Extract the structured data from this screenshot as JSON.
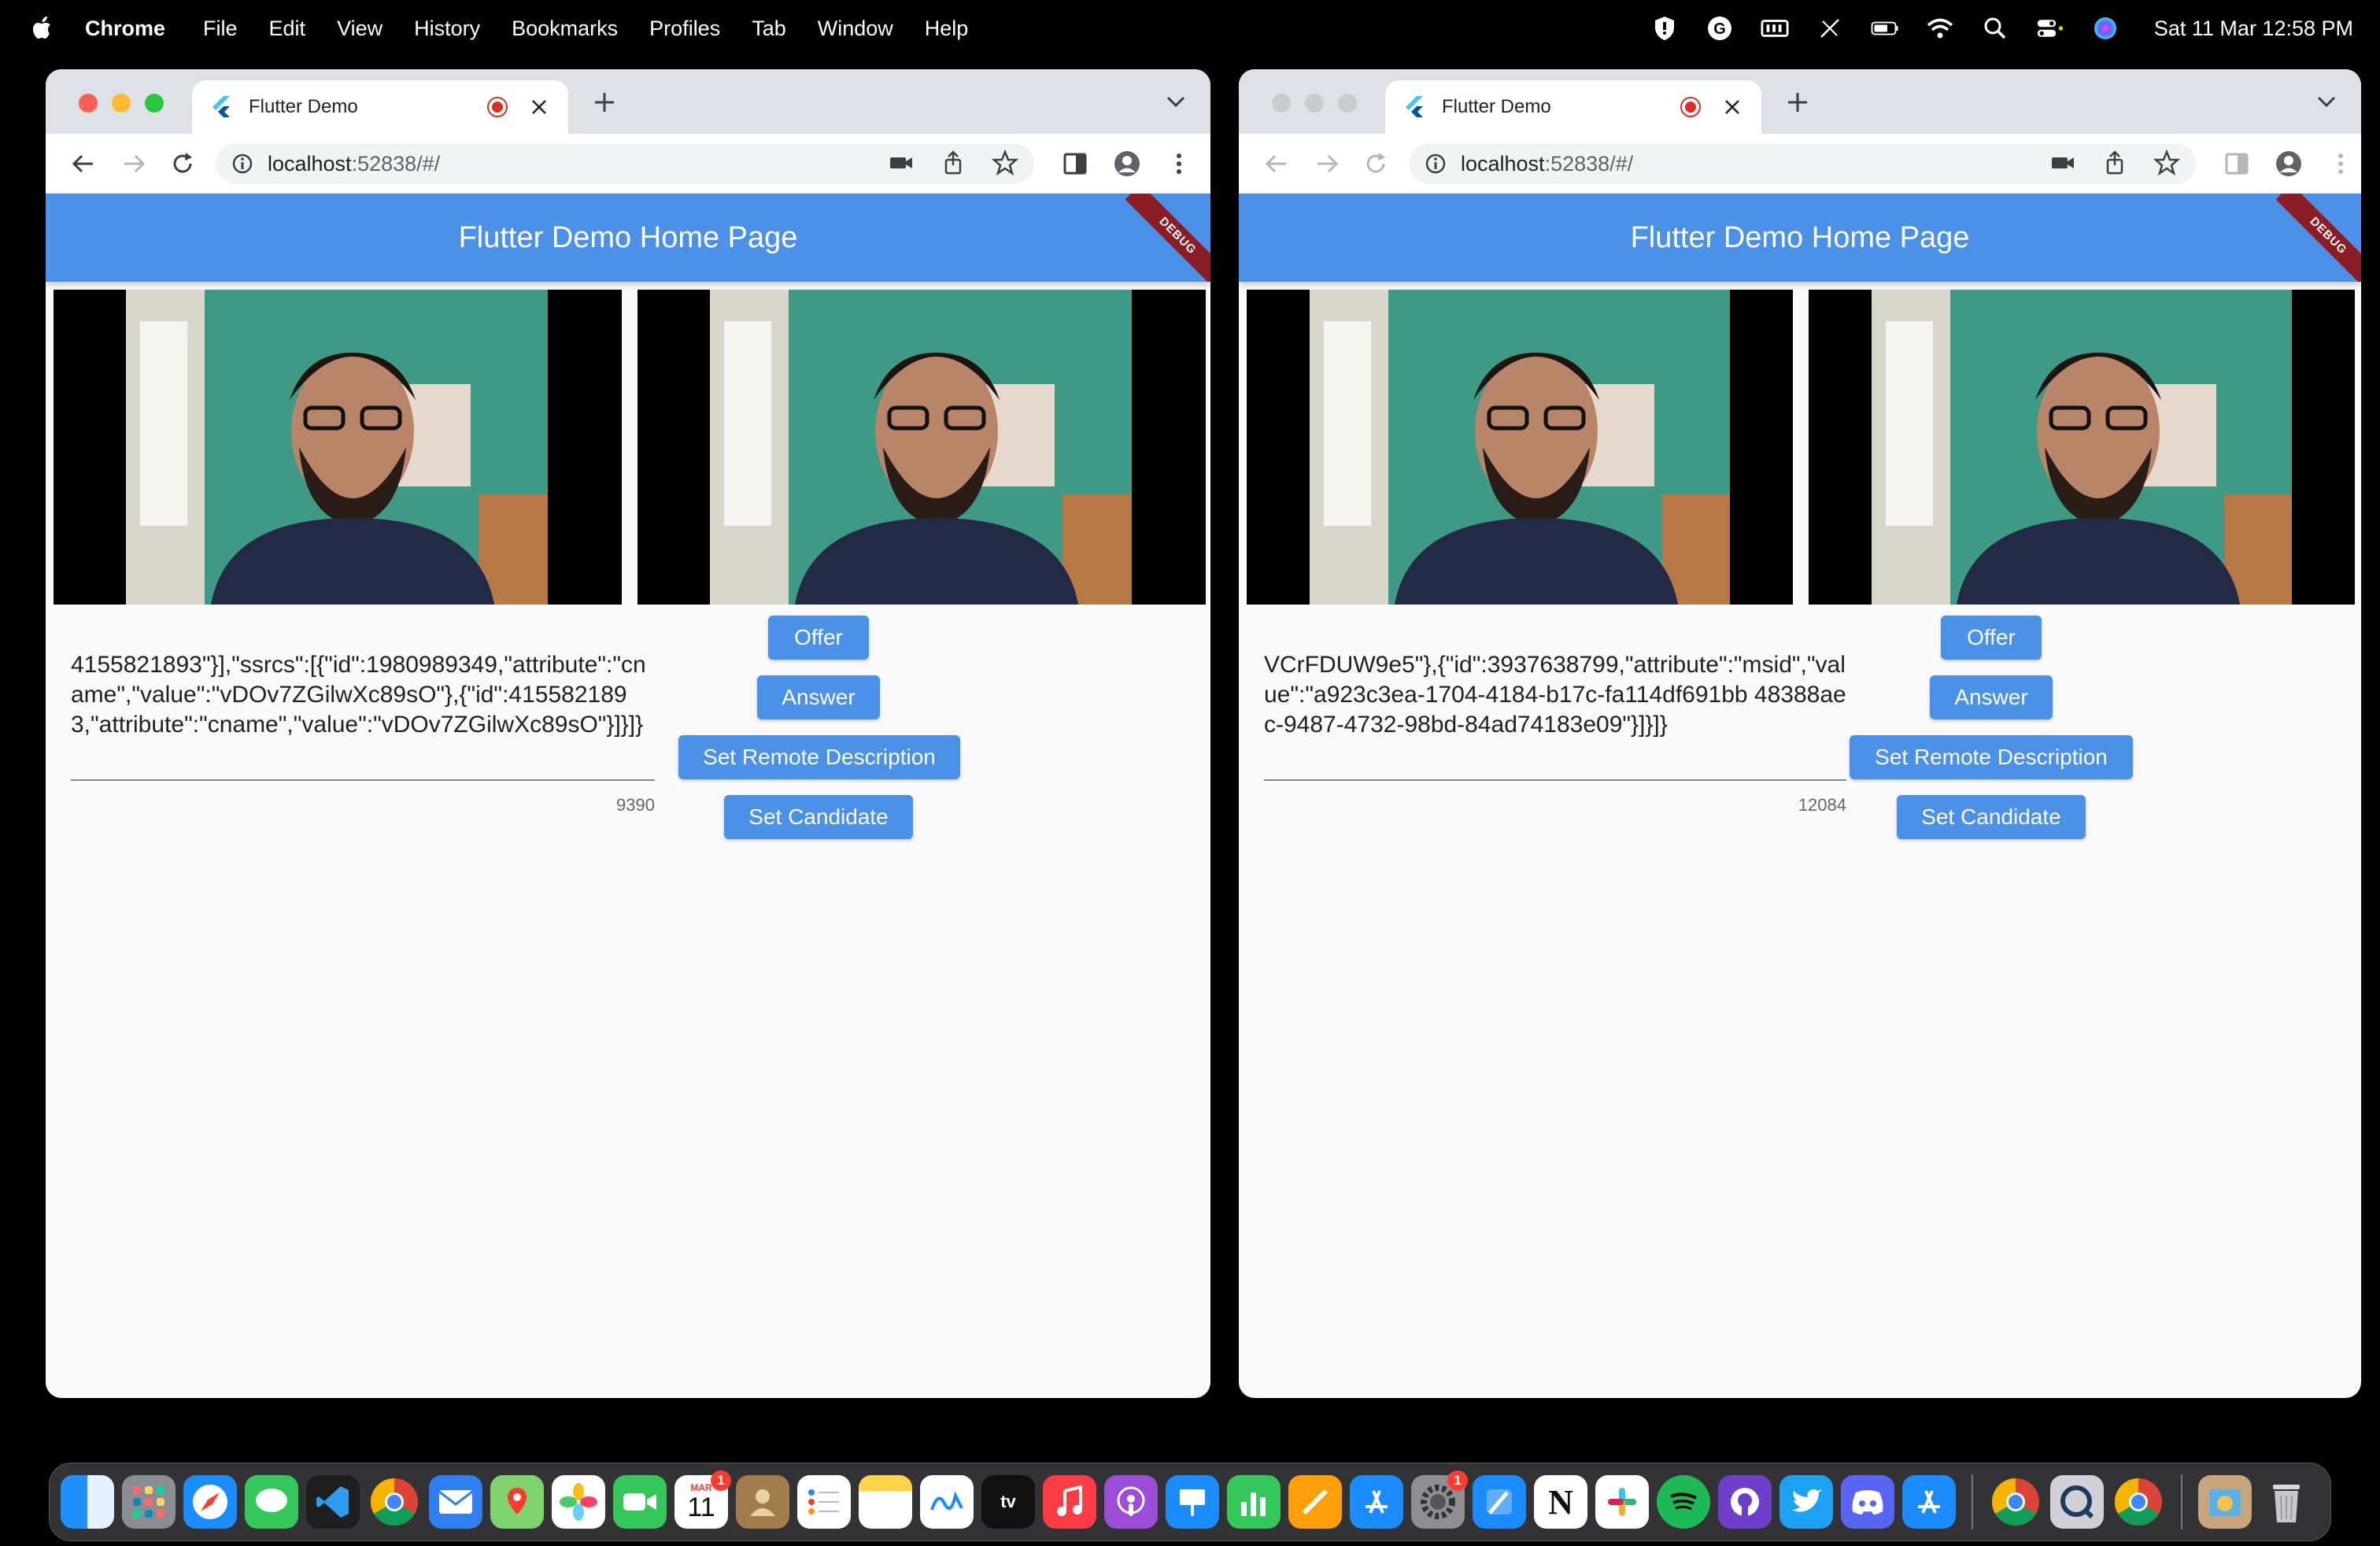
{
  "menubar": {
    "app_name": "Chrome",
    "menus": [
      "File",
      "Edit",
      "View",
      "History",
      "Bookmarks",
      "Profiles",
      "Tab",
      "Window",
      "Help"
    ],
    "clock": "Sat 11 Mar  12:58 PM"
  },
  "windows": [
    {
      "tab_title": "Flutter Demo",
      "url_host": "localhost",
      "url_rest": ":52838/#/",
      "app_title": "Flutter Demo Home Page",
      "debug_label": "DEBUG",
      "sdp_text": "4155821893\"}],\"ssrcs\":[{\"id\":1980989349,\"attribute\":\"cname\",\"value\":\"vDOv7ZGilwXc89sO\"},{\"id\":4155821893,\"attribute\":\"cname\",\"value\":\"vDOv7ZGilwXc89sO\"}]}]}",
      "char_count": "9390",
      "buttons": {
        "offer": "Offer",
        "answer": "Answer",
        "set_remote": "Set Remote Description",
        "set_candidate": "Set Candidate"
      }
    },
    {
      "tab_title": "Flutter Demo",
      "url_host": "localhost",
      "url_rest": ":52838/#/",
      "app_title": "Flutter Demo Home Page",
      "debug_label": "DEBUG",
      "sdp_text": "VCrFDUW9e5\"},{\"id\":3937638799,\"attribute\":\"msid\",\"value\":\"a923c3ea-1704-4184-b17c-fa114df691bb 48388aec-9487-4732-98bd-84ad74183e09\"}]}]}",
      "char_count": "12084",
      "buttons": {
        "offer": "Offer",
        "answer": "Answer",
        "set_remote": "Set Remote Description",
        "set_candidate": "Set Candidate"
      }
    }
  ],
  "dock": {
    "calendar_month": "MAR",
    "calendar_day": "11",
    "calendar_badge": "1",
    "settings_badge": "1",
    "apple_tv_label": "tv",
    "notion_label": "N"
  },
  "colors": {
    "appbar": "#4a91e7",
    "button": "#4a91e7",
    "debug_banner": "#8b1e25",
    "tabstrip": "#dee1e6"
  }
}
